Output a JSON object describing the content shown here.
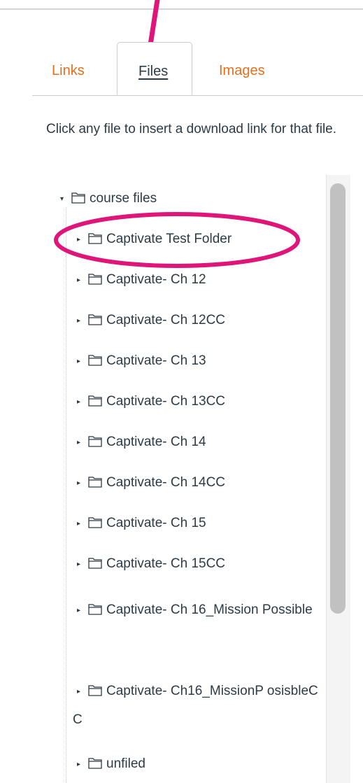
{
  "tabs": {
    "links_label": "Links",
    "files_label": "Files",
    "images_label": "Images"
  },
  "instructions": "Click any file to insert a download link for that file.",
  "tree": {
    "root_label": "course files",
    "items": [
      {
        "label": "Captivate Test Folder"
      },
      {
        "label": "Captivate- Ch 12"
      },
      {
        "label": "Captivate- Ch 12CC"
      },
      {
        "label": "Captivate- Ch 13"
      },
      {
        "label": "Captivate- Ch 13CC"
      },
      {
        "label": "Captivate- Ch 14"
      },
      {
        "label": "Captivate- Ch 14CC"
      },
      {
        "label": "Captivate- Ch 15"
      },
      {
        "label": "Captivate- Ch 15CC"
      },
      {
        "label": "Captivate- Ch 16_Mission Possible"
      },
      {
        "label": "Captivate- Ch16_MissionP osisbleCC"
      },
      {
        "label": "unfiled"
      }
    ]
  },
  "colors": {
    "accent": "#e66f1e",
    "annotation": "#e0157a",
    "text": "#2d3b45"
  },
  "icons": {
    "expand": "triangle-expand-icon",
    "folder": "folder-icon"
  }
}
